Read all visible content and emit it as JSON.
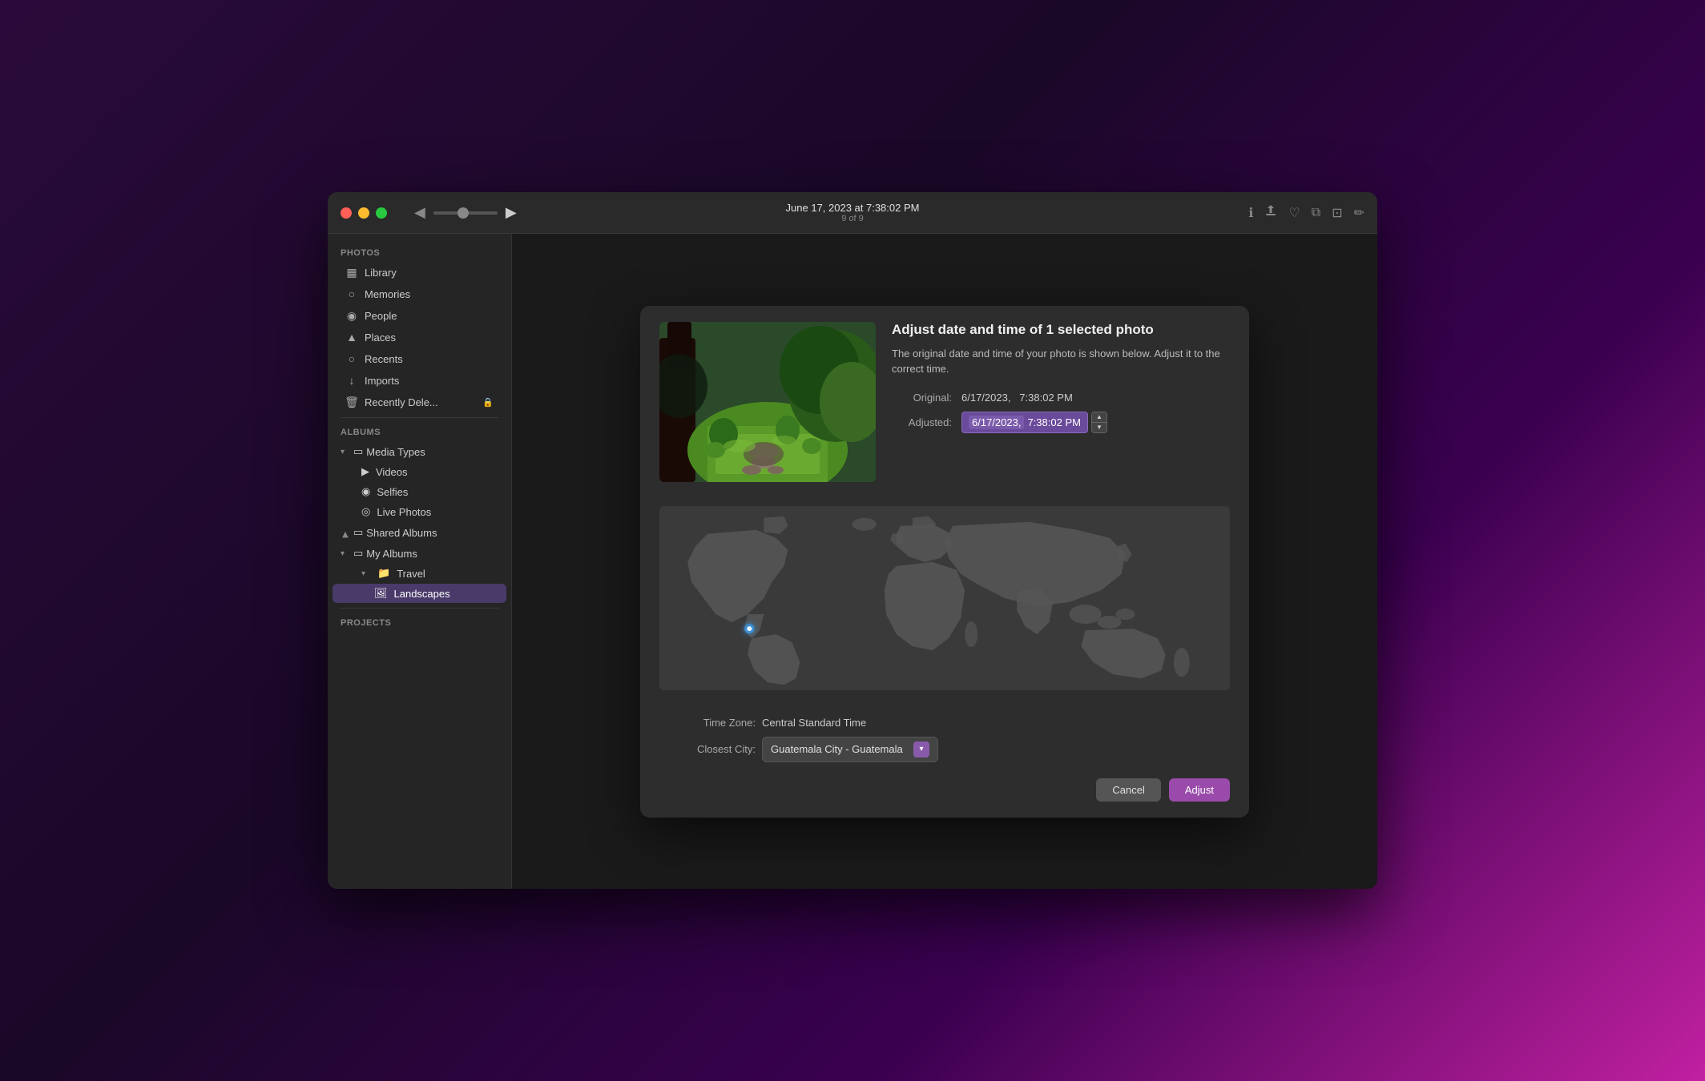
{
  "window": {
    "title": "June 17, 2023 at 7:38:02 PM",
    "subtitle": "9 of 9",
    "traffic_lights": {
      "red_label": "close",
      "yellow_label": "minimize",
      "green_label": "fullscreen"
    }
  },
  "toolbar": {
    "back_icon": "◀",
    "forward_icon": "▶",
    "info_icon": "ℹ",
    "share_icon": "↑",
    "heart_icon": "♡",
    "duplicate_icon": "⧉",
    "crop_icon": "⊡",
    "edit_icon": "✏"
  },
  "sidebar": {
    "photos_label": "Photos",
    "albums_label": "Albums",
    "projects_label": "Projects",
    "items": [
      {
        "id": "library",
        "label": "Library",
        "icon": "▦"
      },
      {
        "id": "memories",
        "label": "Memories",
        "icon": "○"
      },
      {
        "id": "people",
        "label": "People",
        "icon": "◉"
      },
      {
        "id": "places",
        "label": "Places",
        "icon": "▲"
      },
      {
        "id": "recents",
        "label": "Recents",
        "icon": "○"
      },
      {
        "id": "imports",
        "label": "Imports",
        "icon": "↓"
      },
      {
        "id": "recently-deleted",
        "label": "Recently Dele...",
        "icon": "🗑",
        "lock": true
      }
    ],
    "media_types": {
      "label": "Media Types",
      "children": [
        {
          "id": "videos",
          "label": "Videos",
          "icon": "▶"
        },
        {
          "id": "selfies",
          "label": "Selfies",
          "icon": "◉"
        },
        {
          "id": "live-photos",
          "label": "Live Photos",
          "icon": "◎"
        }
      ]
    },
    "shared_albums": {
      "label": "Shared Albums",
      "expanded": false
    },
    "my_albums": {
      "label": "My Albums",
      "expanded": true,
      "children": [
        {
          "id": "travel",
          "label": "Travel",
          "expanded": true,
          "children": [
            {
              "id": "landscapes",
              "label": "Landscapes",
              "active": true
            }
          ]
        }
      ]
    }
  },
  "dialog": {
    "title": "Adjust date and time of 1 selected photo",
    "description": "The original date and time of your photo is shown below. Adjust it to the correct time.",
    "original_label": "Original:",
    "original_date": "6/17/2023,",
    "original_time": "7:38:02 PM",
    "adjusted_label": "Adjusted:",
    "adjusted_date": "6/17/2023,",
    "adjusted_time": "7:38:02 PM",
    "timezone_label": "Time Zone:",
    "timezone_value": "Central Standard Time",
    "city_label": "Closest City:",
    "city_value": "Guatemala City - Guatemala",
    "cancel_button": "Cancel",
    "adjust_button": "Adjust"
  },
  "map": {
    "location_x": "28%",
    "location_y": "58%"
  }
}
